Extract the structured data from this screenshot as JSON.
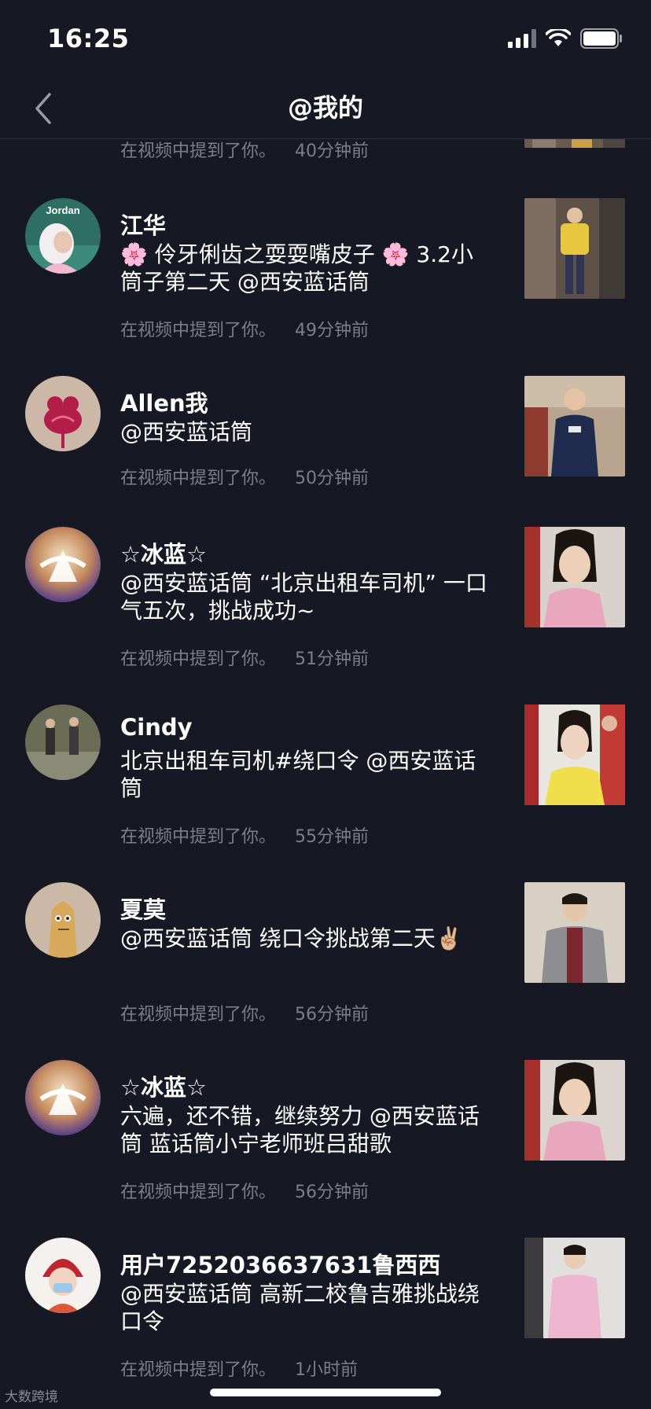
{
  "status": {
    "time": "16:25"
  },
  "header": {
    "title": "@我的"
  },
  "partial_row": {
    "time_label": "在视频中提到了你。",
    "time_ago": "40分钟前"
  },
  "items": [
    {
      "user": "江华",
      "content": "🌸 伶牙俐齿之耍耍嘴皮子 🌸 3.2小筒子第二天 @西安蓝话筒",
      "mention": "在视频中提到了你。",
      "ago": "49分钟前"
    },
    {
      "user": "Allen我",
      "content": "@西安蓝话筒",
      "mention": "在视频中提到了你。",
      "ago": "50分钟前"
    },
    {
      "user": "☆冰蓝☆",
      "content": "@西安蓝话筒 “北京出租车司机” 一口气五次，挑战成功~",
      "mention": "在视频中提到了你。",
      "ago": "51分钟前"
    },
    {
      "user": "Cindy",
      "content": "北京出租车司机#绕口令 @西安蓝话筒",
      "mention": "在视频中提到了你。",
      "ago": "55分钟前"
    },
    {
      "user": "夏莫",
      "content": "@西安蓝话筒 绕口令挑战第二天✌🏼",
      "mention": "在视频中提到了你。",
      "ago": "56分钟前"
    },
    {
      "user": "☆冰蓝☆",
      "content": "六遍，还不错，继续努力 @西安蓝话筒 蓝话筒小宁老师班吕甜歌",
      "mention": "在视频中提到了你。",
      "ago": "56分钟前"
    },
    {
      "user": "用户7252036637631鲁西西",
      "content": "@西安蓝话筒 高新二校鲁吉雅挑战绕口令",
      "mention": "在视频中提到了你。",
      "ago": "1小时前"
    }
  ],
  "avatar_texts": {
    "jordan": "Jordan"
  },
  "watermark": "大数跨境"
}
